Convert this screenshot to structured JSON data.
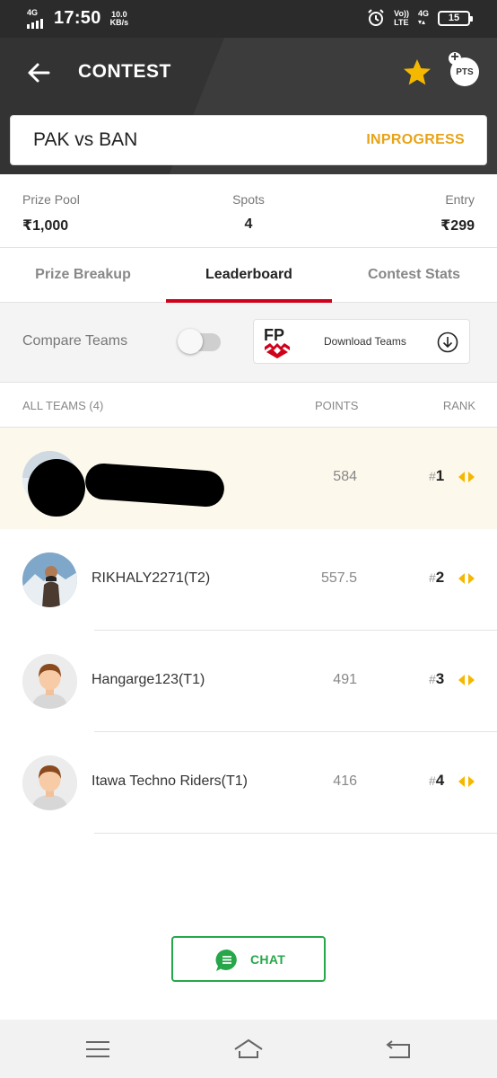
{
  "status_bar": {
    "network": "4G",
    "time": "17:50",
    "speed_value": "10.0",
    "speed_unit": "KB/s",
    "volte_line1": "Vo))",
    "volte_line2": "LTE",
    "net_right_line1": "4G",
    "battery": "15",
    "signal_bars": 4
  },
  "header": {
    "title": "CONTEST",
    "pts_label": "PTS",
    "pts_plus": "+",
    "icons": [
      "back-arrow-icon",
      "star-icon",
      "pts-icon"
    ],
    "star_color": "#f5b800"
  },
  "match": {
    "name": "PAK vs BAN",
    "status": "INPROGRESS",
    "status_color": "#e8a317"
  },
  "prize": {
    "pool_label": "Prize Pool",
    "pool_value": "₹1,000",
    "spots_label": "Spots",
    "spots_value": "4",
    "entry_label": "Entry",
    "entry_value": "₹299"
  },
  "tabs": [
    {
      "label": "Prize Breakup",
      "active": false
    },
    {
      "label": "Leaderboard",
      "active": true
    },
    {
      "label": "Contest Stats",
      "active": false
    }
  ],
  "accent_color": "#d0011b",
  "compare": {
    "label": "Compare Teams",
    "enabled": false,
    "download_label": "Download Teams",
    "fp_logo_text": "FP"
  },
  "list_header": {
    "teams": "ALL TEAMS (4)",
    "points": "POINTS",
    "rank": "RANK"
  },
  "rows": [
    {
      "name": "",
      "points": "584",
      "rank_hash": "#",
      "rank": "1",
      "highlight": true,
      "redacted": true
    },
    {
      "name": "RIKHALY2271(T2)",
      "points": "557.5",
      "rank_hash": "#",
      "rank": "2",
      "highlight": false,
      "avatar": "photo"
    },
    {
      "name": "Hangarge123(T1)",
      "points": "491",
      "rank_hash": "#",
      "rank": "3",
      "highlight": false,
      "avatar": "default"
    },
    {
      "name": "Itawa Techno Riders(T1)",
      "points": "416",
      "rank_hash": "#",
      "rank": "4",
      "highlight": false,
      "avatar": "default"
    }
  ],
  "chat": {
    "label": "CHAT",
    "color": "#27a74a"
  },
  "nav": [
    "menu-icon",
    "home-icon",
    "back-icon"
  ]
}
